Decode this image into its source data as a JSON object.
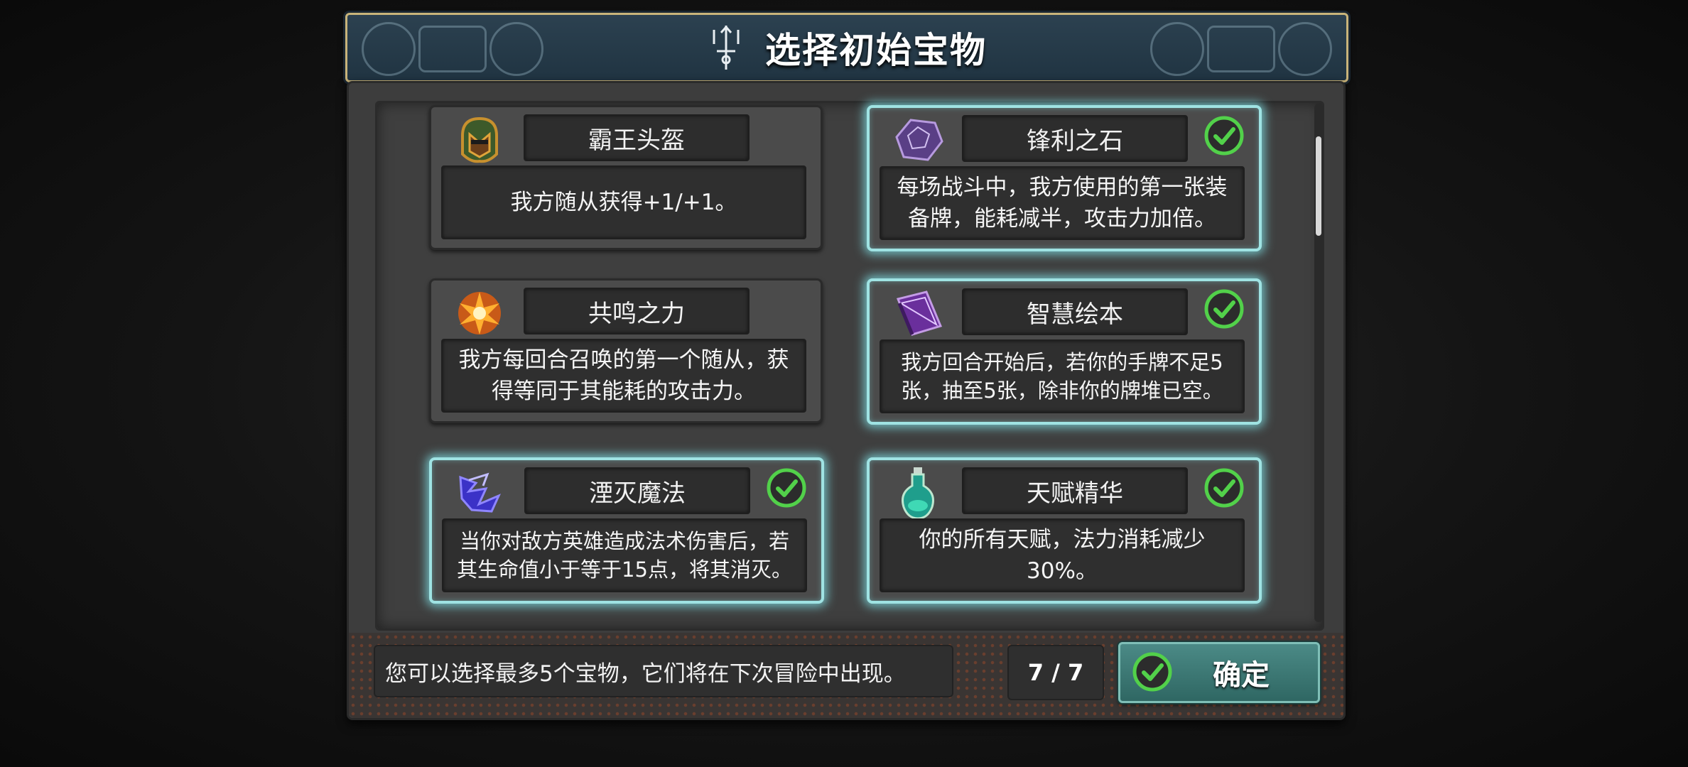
{
  "header": {
    "title": "选择初始宝物"
  },
  "treasures": [
    {
      "name": "霸王头盔",
      "description": "我方随从获得+1/+1。",
      "selected": false,
      "icon": "helmet-icon"
    },
    {
      "name": "锋利之石",
      "description": "每场战斗中，我方使用的第一张装备牌，能耗减半，攻击力加倍。",
      "selected": true,
      "icon": "sharp-stone-icon"
    },
    {
      "name": "共鸣之力",
      "description": "我方每回合召唤的第一个随从，获得等同于其能耗的攻击力。",
      "selected": false,
      "icon": "resonance-icon"
    },
    {
      "name": "智慧绘本",
      "description": "我方回合开始后，若你的手牌不足5张，抽至5张，除非你的牌堆已空。",
      "selected": true,
      "icon": "book-icon"
    },
    {
      "name": "湮灭魔法",
      "description": "当你对敌方英雄造成法术伤害后，若其生命值小于等于15点，将其消灭。",
      "selected": true,
      "icon": "annihilation-icon"
    },
    {
      "name": "天赋精华",
      "description": "你的所有天赋，法力消耗减少30%。",
      "selected": true,
      "icon": "potion-icon"
    }
  ],
  "footer": {
    "hint": "您可以选择最多5个宝物，它们将在下次冒险中出现。",
    "count": "7 / 7",
    "confirm_label": "确定"
  },
  "colors": {
    "selected_glow": "#9fe3e3",
    "check_green": "#52d14a",
    "confirm_bg": "#3d7a76",
    "header_border": "#c9b47a"
  }
}
